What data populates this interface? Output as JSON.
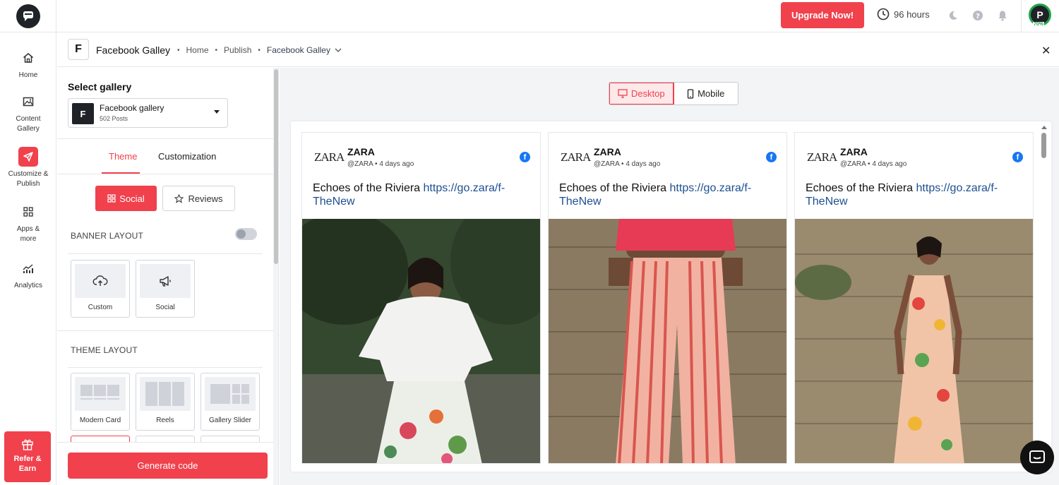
{
  "topbar": {
    "upgrade_label": "Upgrade Now!",
    "hours_label": "96 hours",
    "avatar_initial": "P",
    "avatar_progress": "70%"
  },
  "nav": {
    "items": [
      {
        "label": "Home",
        "icon": "home-icon"
      },
      {
        "label": "Content Gallery",
        "icon": "image-icon"
      },
      {
        "label": "Customize & Publish",
        "icon": "send-icon"
      },
      {
        "label": "Apps & more",
        "icon": "grid-icon"
      },
      {
        "label": "Analytics",
        "icon": "analytics-icon"
      }
    ],
    "refer_label": "Refer & Earn"
  },
  "header": {
    "logo_letter": "F",
    "title": "Facebook Galley",
    "breadcrumb": [
      "Home",
      "Publish",
      "Facebook Galley"
    ]
  },
  "panel": {
    "select_gallery_label": "Select gallery",
    "gallery": {
      "initial": "F",
      "name": "Facebook gallery",
      "count": "502 Posts"
    },
    "tabs": [
      "Theme",
      "Customization"
    ],
    "social_label": "Social",
    "reviews_label": "Reviews",
    "banner_layout_title": "BANNER LAYOUT",
    "banner_options": [
      "Custom",
      "Social"
    ],
    "theme_layout_title": "THEME LAYOUT",
    "theme_options": [
      "Modern Card",
      "Reels",
      "Gallery Slider"
    ],
    "generate_label": "Generate code"
  },
  "preview": {
    "desktop_label": "Desktop",
    "mobile_label": "Mobile",
    "posts": [
      {
        "brand_logo": "ZARA",
        "brand": "ZARA",
        "handle": "@ZARA",
        "time": "4 days ago",
        "caption": "Echoes of the Riviera ",
        "link": "https://go.zara/f-TheNew"
      },
      {
        "brand_logo": "ZARA",
        "brand": "ZARA",
        "handle": "@ZARA",
        "time": "4 days ago",
        "caption": "Echoes of the Riviera ",
        "link": "https://go.zara/f-TheNew"
      },
      {
        "brand_logo": "ZARA",
        "brand": "ZARA",
        "handle": "@ZARA",
        "time": "4 days ago",
        "caption": "Echoes of the Riviera ",
        "link": "https://go.zara/f-TheNew"
      }
    ]
  },
  "colors": {
    "accent": "#f0414d",
    "facebook": "#1877f2",
    "link": "#1d4f91"
  }
}
